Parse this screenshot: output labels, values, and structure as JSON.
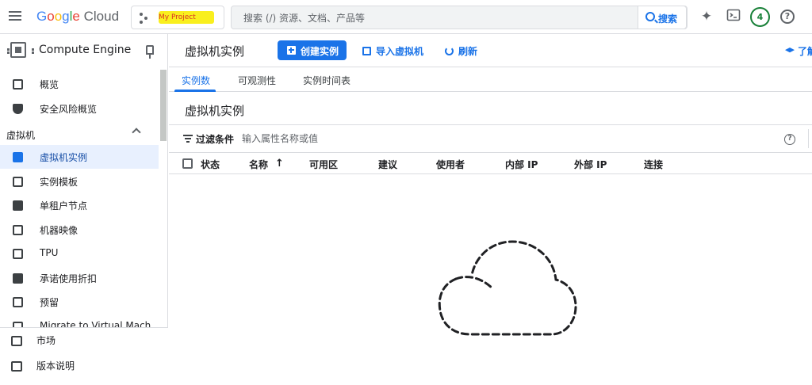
{
  "header": {
    "logo": {
      "g": "G",
      "o1": "o",
      "o2": "o",
      "g2": "g",
      "l": "l",
      "e": "e",
      "cloud": "Cloud"
    },
    "project_name": "My Project",
    "search_placeholder": "搜索 (/) 资源、文档、产品等",
    "search_button": "搜索",
    "notification_count": "4",
    "help_glyph": "?",
    "icons": [
      "menu-icon",
      "project-picker-icon",
      "gemini-icon",
      "cloud-shell-icon",
      "notifications-icon",
      "help-icon"
    ]
  },
  "sidebar": {
    "product_title": "Compute Engine",
    "items_top": [
      {
        "label": "概览",
        "icon": "overview-icon"
      },
      {
        "label": "安全风险概览",
        "icon": "shield-icon"
      }
    ],
    "section_label": "虚拟机",
    "section_items": [
      {
        "label": "虚拟机实例",
        "icon": "vm-instance-icon",
        "active": true
      },
      {
        "label": "实例模板",
        "icon": "template-icon"
      },
      {
        "label": "单租户节点",
        "icon": "sole-tenant-icon"
      },
      {
        "label": "机器映像",
        "icon": "machine-image-icon"
      },
      {
        "label": "TPU",
        "icon": "tpu-icon"
      },
      {
        "label": "承诺使用折扣",
        "icon": "discount-icon"
      },
      {
        "label": "预留",
        "icon": "reservation-icon"
      },
      {
        "label": "Migrate to Virtual Mach",
        "icon": "migrate-icon"
      }
    ],
    "footer_items": [
      {
        "label": "市场",
        "icon": "marketplace-icon"
      },
      {
        "label": "版本说明",
        "icon": "release-notes-icon"
      }
    ]
  },
  "main": {
    "page_title": "虚拟机实例",
    "create_button": "创建实例",
    "import_button": "导入虚拟机",
    "refresh_button": "刷新",
    "learn_button": "了解",
    "tabs": [
      {
        "label": "实例数",
        "active": true
      },
      {
        "label": "可观测性"
      },
      {
        "label": "实例时间表"
      }
    ],
    "section_title": "虚拟机实例",
    "filter_label": "过滤条件",
    "filter_placeholder": "输入属性名称或值",
    "table_columns": [
      "状态",
      "名称",
      "可用区",
      "建议",
      "使用者",
      "内部 IP",
      "外部 IP",
      "连接"
    ],
    "sort_arrow": "↑",
    "sort_column": "名称"
  }
}
